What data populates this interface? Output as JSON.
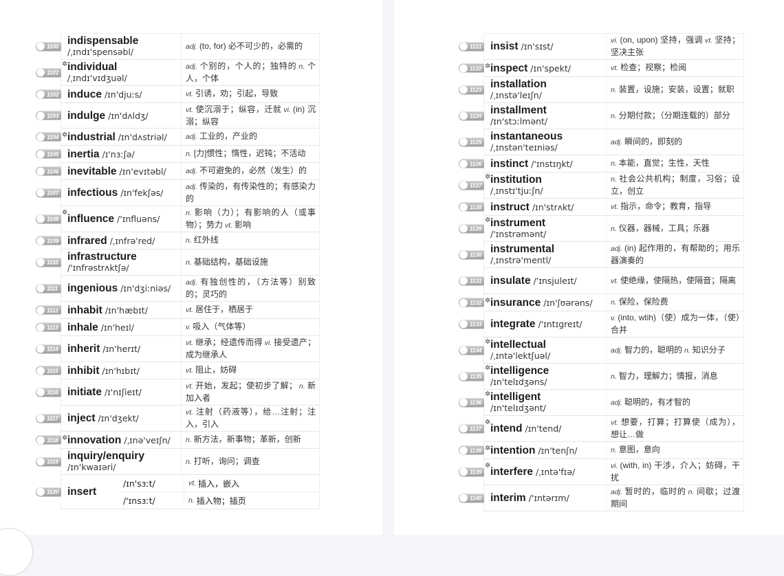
{
  "pages": [
    {
      "entries": [
        {
          "num": "1100",
          "word": "indispensable",
          "ipa": "/ˌɪndɪ'spensəbl/",
          "layout": "stack",
          "star": false,
          "h": 38,
          "defs": [
            {
              "pos": "adj.",
              "text": "(to, for) 必不可少的，必需的"
            }
          ]
        },
        {
          "num": "1101",
          "word": "individual",
          "ipa": "/ˌɪndɪ'vɪdʒuəl/",
          "layout": "stack",
          "star": true,
          "h": 38,
          "defs": [
            {
              "pos": "adj.",
              "text": "个别的，个人的；独特的"
            },
            {
              "pos": "n.",
              "text": "个人，个体"
            }
          ]
        },
        {
          "num": "1102",
          "word": "induce",
          "ipa": "/ɪn'djuːs/",
          "layout": "inline",
          "star": false,
          "h": 25,
          "defs": [
            {
              "pos": "vt.",
              "text": "引诱，劝；引起，导致"
            }
          ]
        },
        {
          "num": "1103",
          "word": "indulge",
          "ipa": "/ɪn'dʌldʒ/",
          "layout": "inline",
          "star": false,
          "h": 37,
          "defs": [
            {
              "pos": "vt.",
              "text": "使沉溺于；纵容，迁就"
            },
            {
              "pos": "vi.",
              "text": "(in) 沉溺；纵容"
            }
          ]
        },
        {
          "num": "1104",
          "word": "industrial",
          "ipa": "/ɪn'dʌstriəl/",
          "layout": "inline",
          "star": true,
          "h": 25,
          "defs": [
            {
              "pos": "adj.",
              "text": "工业的，产业的"
            }
          ]
        },
        {
          "num": "1105",
          "word": "inertia",
          "ipa": "/ɪ'nɜːʃə/",
          "layout": "inline",
          "star": false,
          "h": 25,
          "defs": [
            {
              "pos": "n.",
              "text": "[力]惯性；惰性，迟钝；不活动"
            }
          ]
        },
        {
          "num": "1106",
          "word": "inevitable",
          "ipa": "/ɪn'evɪtəbl/",
          "layout": "inline",
          "star": false,
          "h": 25,
          "defs": [
            {
              "pos": "adj.",
              "text": "不可避免的，必然（发生）的"
            }
          ]
        },
        {
          "num": "1107",
          "word": "infectious",
          "ipa": "/ɪn'fekʃəs/",
          "layout": "inline",
          "star": false,
          "h": 38,
          "defs": [
            {
              "pos": "adj.",
              "text": "传染的，有传染性的；有感染力的"
            }
          ]
        },
        {
          "num": "1108",
          "word": "influence",
          "ipa": "/'ɪnfluəns/",
          "layout": "inline",
          "star": true,
          "h": 38,
          "defs": [
            {
              "pos": "n.",
              "text": "影响（力）；有影响的人（或事物）；势力"
            },
            {
              "pos": "vt.",
              "text": "影响"
            }
          ]
        },
        {
          "num": "1109",
          "word": "infrared",
          "ipa": "/ˌɪnfrə'red/",
          "layout": "inline",
          "star": false,
          "h": 25,
          "defs": [
            {
              "pos": "n.",
              "text": "红外线"
            }
          ]
        },
        {
          "num": "1110",
          "word": "infrastructure",
          "ipa": "/'ɪnfrəstrʌktʃə/",
          "layout": "stack",
          "star": false,
          "h": 38,
          "defs": [
            {
              "pos": "n.",
              "text": "基础结构，基础设施"
            }
          ]
        },
        {
          "num": "1111",
          "word": "ingenious",
          "ipa": "/ɪn'dʒiːniəs/",
          "layout": "inline",
          "star": false,
          "h": 38,
          "defs": [
            {
              "pos": "adj.",
              "text": "有独创性的，（方法等）别致的；灵巧的"
            }
          ]
        },
        {
          "num": "1112",
          "word": "inhabit",
          "ipa": "/ɪn'hæbɪt/",
          "layout": "inline",
          "star": false,
          "h": 25,
          "defs": [
            {
              "pos": "vt.",
              "text": "居住于，栖居于"
            }
          ]
        },
        {
          "num": "1113",
          "word": "inhale",
          "ipa": "/ɪn'heɪl/",
          "layout": "inline",
          "star": false,
          "h": 25,
          "defs": [
            {
              "pos": "v.",
              "text": "吸入（气体等）"
            }
          ]
        },
        {
          "num": "1114",
          "word": "inherit",
          "ipa": "/ɪn'herɪt/",
          "layout": "inline",
          "star": false,
          "h": 38,
          "defs": [
            {
              "pos": "vt.",
              "text": "继承；经遗传而得"
            },
            {
              "pos": "vi.",
              "text": "接受遗产；成为继承人"
            }
          ]
        },
        {
          "num": "1115",
          "word": "inhibit",
          "ipa": "/ɪn'hɪbɪt/",
          "layout": "inline",
          "star": false,
          "h": 25,
          "defs": [
            {
              "pos": "vt.",
              "text": "阻止，妨碍"
            }
          ]
        },
        {
          "num": "1116",
          "word": "initiate",
          "ipa": "/ɪ'nɪʃieɪt/",
          "layout": "inline",
          "star": false,
          "h": 38,
          "defs": [
            {
              "pos": "vt.",
              "text": "开始，发起；使初步了解；"
            },
            {
              "pos": "n.",
              "text": "新加入者"
            }
          ]
        },
        {
          "num": "1117",
          "word": "inject",
          "ipa": "/ɪn'dʒekt/",
          "layout": "inline",
          "star": false,
          "h": 38,
          "defs": [
            {
              "pos": "vt.",
              "text": "注射（药液等），给…注射；注入，引入"
            }
          ]
        },
        {
          "num": "1118",
          "word": "innovation",
          "ipa": "/ˌɪnə'veɪʃn/",
          "layout": "inline",
          "star": true,
          "h": 25,
          "defs": [
            {
              "pos": "n.",
              "text": "新方法，新事物；革新，创新"
            }
          ]
        },
        {
          "num": "1119",
          "word": "inquiry/enquiry",
          "ipa": "/ɪn'kwaɪəri/",
          "layout": "stack",
          "star": false,
          "h": 38,
          "defs": [
            {
              "pos": "n.",
              "text": "打听，询问；调查"
            }
          ]
        },
        {
          "num": "1120",
          "word": "insert",
          "layout": "split",
          "star": false,
          "h": 50,
          "senses": [
            {
              "ipa": "/ɪn'sɜːt/",
              "pos": "vt.",
              "text": "插入，嵌入"
            },
            {
              "ipa": "/'ɪnsɜːt/",
              "pos": "n.",
              "text": "插入物；插页"
            }
          ]
        }
      ]
    },
    {
      "entries": [
        {
          "num": "1121",
          "word": "insist",
          "ipa": "/ɪn'sɪst/",
          "layout": "inline",
          "star": false,
          "h": 38,
          "defs": [
            {
              "pos": "vi.",
              "text": "(on, upon) 坚持，强调"
            },
            {
              "pos": "vt.",
              "text": "坚持；坚决主张"
            }
          ]
        },
        {
          "num": "1122",
          "word": "inspect",
          "ipa": "/ɪn'spekt/",
          "layout": "inline",
          "star": true,
          "h": 25,
          "defs": [
            {
              "pos": "vt.",
              "text": "检查；视察；检阅"
            }
          ]
        },
        {
          "num": "1123",
          "word": "installation",
          "ipa": "/ˌɪnstə'leɪʃn/",
          "layout": "stack",
          "star": false,
          "h": 38,
          "defs": [
            {
              "pos": "n.",
              "text": "装置，设施；安装，设置；就职"
            }
          ]
        },
        {
          "num": "1124",
          "word": "installment",
          "ipa": "/ɪn'stɔːlmənt/",
          "layout": "stack",
          "star": false,
          "h": 38,
          "defs": [
            {
              "pos": "n.",
              "text": "分期付款；（分期连载的）部分"
            }
          ]
        },
        {
          "num": "1125",
          "word": "instantaneous",
          "ipa": "/ˌɪnstən'teɪniəs/",
          "layout": "stack",
          "star": false,
          "h": 38,
          "defs": [
            {
              "pos": "adj.",
              "text": "瞬间的，即刻的"
            }
          ]
        },
        {
          "num": "1126",
          "word": "instinct",
          "ipa": "/'ɪnstɪŋkt/",
          "layout": "inline",
          "star": false,
          "h": 25,
          "defs": [
            {
              "pos": "n.",
              "text": "本能，直觉；生性，天性"
            }
          ]
        },
        {
          "num": "1127",
          "word": "institution",
          "ipa": "/ˌɪnstɪ'tjuːʃn/",
          "layout": "stack",
          "star": true,
          "h": 38,
          "defs": [
            {
              "pos": "n.",
              "text": "社会公共机构；制度，习俗；设立，创立"
            }
          ]
        },
        {
          "num": "1128",
          "word": "instruct",
          "ipa": "/ɪn'strʌkt/",
          "layout": "inline",
          "star": false,
          "h": 25,
          "defs": [
            {
              "pos": "vt.",
              "text": "指示，命令；教育，指导"
            }
          ]
        },
        {
          "num": "1129",
          "word": "instrument",
          "ipa": "/'ɪnstrəmənt/",
          "layout": "stack",
          "star": true,
          "h": 38,
          "defs": [
            {
              "pos": "n.",
              "text": "仪器，器械，工具；乐器"
            }
          ]
        },
        {
          "num": "1130",
          "word": "instrumental",
          "ipa": "/ˌɪnstrə'mentl/",
          "layout": "stack",
          "star": false,
          "h": 38,
          "defs": [
            {
              "pos": "adj.",
              "text": "(in) 起作用的，有帮助的；用乐器演奏的"
            }
          ]
        },
        {
          "num": "1131",
          "word": "insulate",
          "ipa": "/'ɪnsjuleɪt/",
          "layout": "inline",
          "star": false,
          "h": 38,
          "defs": [
            {
              "pos": "vt.",
              "text": "使绝缘，使隔热，使隔音；隔离"
            }
          ]
        },
        {
          "num": "1132",
          "word": "insurance",
          "ipa": "/ɪn'ʃʊərəns/",
          "layout": "inline",
          "star": true,
          "h": 25,
          "defs": [
            {
              "pos": "n.",
              "text": "保险，保险费"
            }
          ]
        },
        {
          "num": "1133",
          "word": "integrate",
          "ipa": "/'ɪntɪgreɪt/",
          "layout": "inline",
          "star": false,
          "h": 38,
          "defs": [
            {
              "pos": "v.",
              "text": "(into, wtih)（使）成为一体，（使）合并"
            }
          ]
        },
        {
          "num": "1134",
          "word": "intellectual",
          "ipa": "/ˌɪntə'lektʃuəl/",
          "layout": "stack",
          "star": true,
          "h": 38,
          "defs": [
            {
              "pos": "adj.",
              "text": "智力的，聪明的"
            },
            {
              "pos": "n.",
              "text": "知识分子"
            }
          ]
        },
        {
          "num": "1135",
          "word": "intelligence",
          "ipa": "/ɪn'telɪdʒəns/",
          "layout": "stack",
          "star": true,
          "h": 38,
          "defs": [
            {
              "pos": "n.",
              "text": "智力，理解力；情报，消息"
            }
          ]
        },
        {
          "num": "1136",
          "word": "intelligent",
          "ipa": "/ɪn'telɪdʒənt/",
          "layout": "stack",
          "star": true,
          "h": 38,
          "defs": [
            {
              "pos": "adj.",
              "text": "聪明的，有才智的"
            }
          ]
        },
        {
          "num": "1137",
          "word": "intend",
          "ipa": "/ɪn'tend/",
          "layout": "inline",
          "star": true,
          "h": 38,
          "defs": [
            {
              "pos": "vt.",
              "text": "想要，打算；打算使（成为），想让…做"
            }
          ]
        },
        {
          "num": "1138",
          "word": "intention",
          "ipa": "/ɪn'tenʃn/",
          "layout": "inline",
          "star": true,
          "h": 25,
          "defs": [
            {
              "pos": "n.",
              "text": "意图，意向"
            }
          ]
        },
        {
          "num": "1139",
          "word": "interfere",
          "ipa": "/ˌɪntə'fɪə/",
          "layout": "inline",
          "star": true,
          "h": 38,
          "defs": [
            {
              "pos": "vi.",
              "text": "(with, in) 干涉，介入；妨碍，干扰"
            }
          ]
        },
        {
          "num": "1140",
          "word": "interim",
          "ipa": "/'ɪntərɪm/",
          "layout": "inline",
          "star": false,
          "h": 38,
          "defs": [
            {
              "pos": "adj.",
              "text": "暂时的，临时的"
            },
            {
              "pos": "n.",
              "text": "间歇；过渡期间"
            }
          ]
        }
      ]
    }
  ],
  "star_glyph": "✲"
}
